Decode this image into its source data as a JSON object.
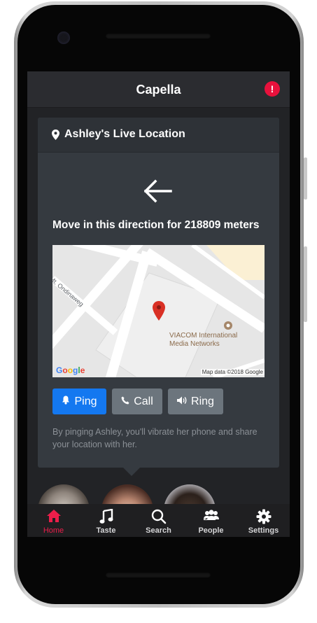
{
  "app": {
    "title": "Capella"
  },
  "alert": {
    "icon": "exclamation-icon",
    "glyph": "!",
    "color": "#e8113c"
  },
  "card": {
    "title": "Ashley's Live Location",
    "direction_text": "Move in this direction for 218809 meters",
    "map": {
      "street_label": "Mt. Ondinaweg",
      "poi_label": "VIACOM International Media Networks",
      "logo": "Google",
      "credit": "Map data ©2018 Google"
    },
    "buttons": {
      "ping": "Ping",
      "call": "Call",
      "ring": "Ring"
    },
    "hint": "By pinging Ashley, you'll vibrate her phone and share your location with her."
  },
  "tabs": [
    {
      "label": "Home",
      "icon": "home-icon",
      "active": true
    },
    {
      "label": "Taste",
      "icon": "music-note-icon",
      "active": false
    },
    {
      "label": "Search",
      "icon": "search-icon",
      "active": false
    },
    {
      "label": "People",
      "icon": "people-icon",
      "active": false
    },
    {
      "label": "Settings",
      "icon": "gear-icon",
      "active": false
    }
  ],
  "colors": {
    "accent": "#ec1e4a",
    "primary_button": "#1478f0",
    "secondary_button": "#6c757d"
  }
}
